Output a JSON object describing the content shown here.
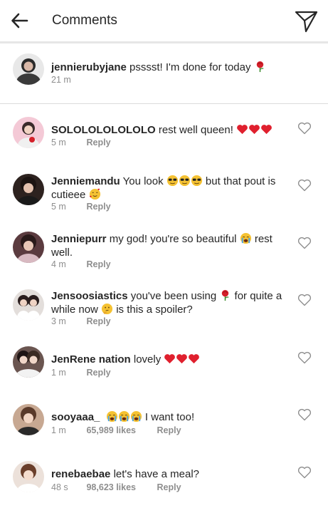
{
  "header": {
    "title": "Comments"
  },
  "caption": {
    "username": "jennierubyjane",
    "text": "psssst! I'm done for today",
    "emoji": "rose",
    "time": "21 m"
  },
  "comments": [
    {
      "username": "SOLOLOLOLOLOLO",
      "text_parts": [
        "rest well queen! "
      ],
      "emoji_after": [
        "heart",
        "heart",
        "heart"
      ],
      "time": "5 m",
      "likes": "",
      "reply_label": "Reply",
      "avatar_bg": "#f4c9d6"
    },
    {
      "username": "Jenniemandu",
      "text_parts": [
        "You look ",
        " but that pout is cutieee "
      ],
      "emoji_mid": [
        "sunglasses",
        "sunglasses",
        "sunglasses"
      ],
      "emoji_after": [
        "smiling-hearts"
      ],
      "time": "5 m",
      "likes": "",
      "reply_label": "Reply",
      "avatar_bg": "#3a2a26"
    },
    {
      "username": "Jenniepurr",
      "text_parts": [
        "my god! you're so beautiful ",
        " rest well."
      ],
      "emoji_mid": [
        "crying"
      ],
      "emoji_after": [],
      "time": "4 m",
      "likes": "",
      "reply_label": "Reply",
      "avatar_bg": "#5b3b3f"
    },
    {
      "username": "Jensoosiastics",
      "text_parts": [
        "you've been using ",
        " for quite a while now ",
        " is this a spoiler?"
      ],
      "emoji_mid": [
        "rose"
      ],
      "emoji_mid2": [
        "thinking"
      ],
      "emoji_after": [],
      "time": "3 m",
      "likes": "",
      "reply_label": "Reply",
      "avatar_bg": "#d8d2cf"
    },
    {
      "username": "JenRene nation",
      "text_parts": [
        "lovely "
      ],
      "emoji_after": [
        "heart",
        "heart",
        "heart"
      ],
      "time": "1 m",
      "likes": "",
      "reply_label": "Reply",
      "avatar_bg": "#4a3a36"
    },
    {
      "username": "sooyaaa_",
      "text_parts": [
        " ",
        " I want too!"
      ],
      "emoji_mid": [
        "crying",
        "crying",
        "crying"
      ],
      "emoji_after": [],
      "time": "1 m",
      "likes": "65,989 likes",
      "reply_label": "Reply",
      "avatar_bg": "#b48a73"
    },
    {
      "username": "renebaebae",
      "text_parts": [
        "let's have a meal?"
      ],
      "emoji_after": [],
      "time": "48 s",
      "likes": "98,623 likes",
      "reply_label": "Reply",
      "avatar_bg": "#e2cfc4"
    }
  ],
  "icons": {
    "back": "back-arrow-icon",
    "share": "paper-plane-icon",
    "like": "heart-outline-icon"
  },
  "colors": {
    "text": "#262626",
    "meta": "#8e8e8e",
    "divider": "#dbdbdb",
    "heart_red": "#e0202e"
  }
}
